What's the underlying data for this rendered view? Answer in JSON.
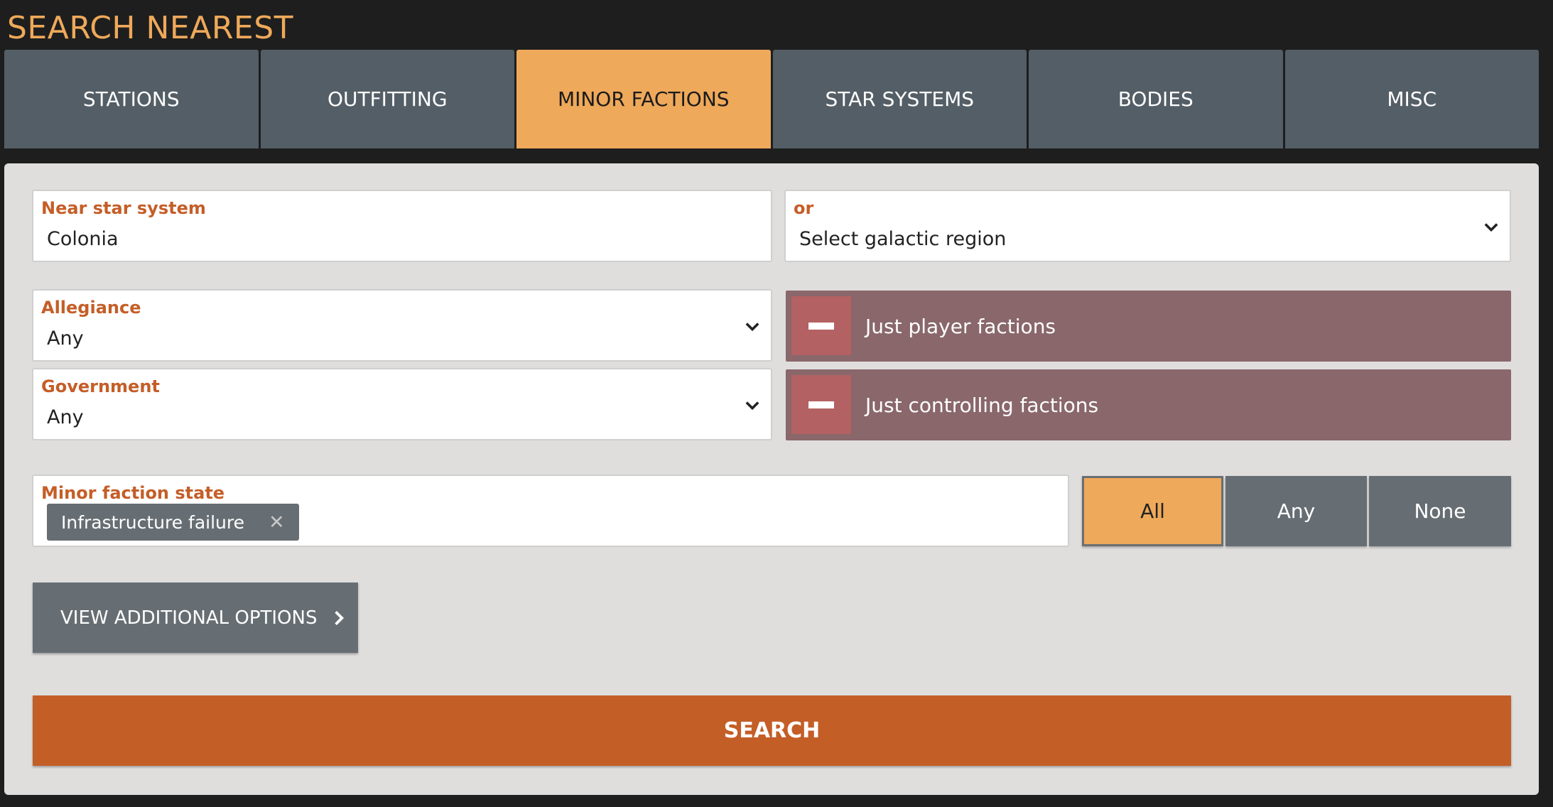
{
  "page": {
    "title": "SEARCH NEAREST"
  },
  "tabs": [
    {
      "label": "STATIONS",
      "active": false
    },
    {
      "label": "OUTFITTING",
      "active": false
    },
    {
      "label": "MINOR FACTIONS",
      "active": true
    },
    {
      "label": "STAR SYSTEMS",
      "active": false
    },
    {
      "label": "BODIES",
      "active": false
    },
    {
      "label": "MISC",
      "active": false
    }
  ],
  "form": {
    "near_system": {
      "label": "Near star system",
      "value": "Colonia"
    },
    "region": {
      "label": "or",
      "value": "Select galactic region"
    },
    "allegiance": {
      "label": "Allegiance",
      "value": "Any"
    },
    "government": {
      "label": "Government",
      "value": "Any"
    },
    "player_factions": {
      "label": "Just player factions"
    },
    "controlling_factions": {
      "label": "Just controlling factions"
    },
    "faction_state": {
      "label": "Minor faction state",
      "chips": [
        "Infrastructure failure"
      ]
    },
    "match_mode": {
      "options": [
        "All",
        "Any",
        "None"
      ],
      "selected": "All"
    },
    "more_options_label": "VIEW ADDITIONAL OPTIONS",
    "search_label": "SEARCH"
  },
  "colors": {
    "accent_orange": "#efa95a",
    "search_orange": "#c45e27",
    "tab_gray": "#545e66",
    "toggle_mauve": "#89676b",
    "toggle_box_red": "#b36163",
    "button_gray": "#676e73",
    "panel_bg": "#dfdedd",
    "page_bg": "#1e1e1e"
  },
  "icons": {
    "dropdown": "chevron-down-icon",
    "toggle_off": "minus-icon",
    "chip_remove": "close-icon",
    "more": "chevron-right-icon"
  }
}
